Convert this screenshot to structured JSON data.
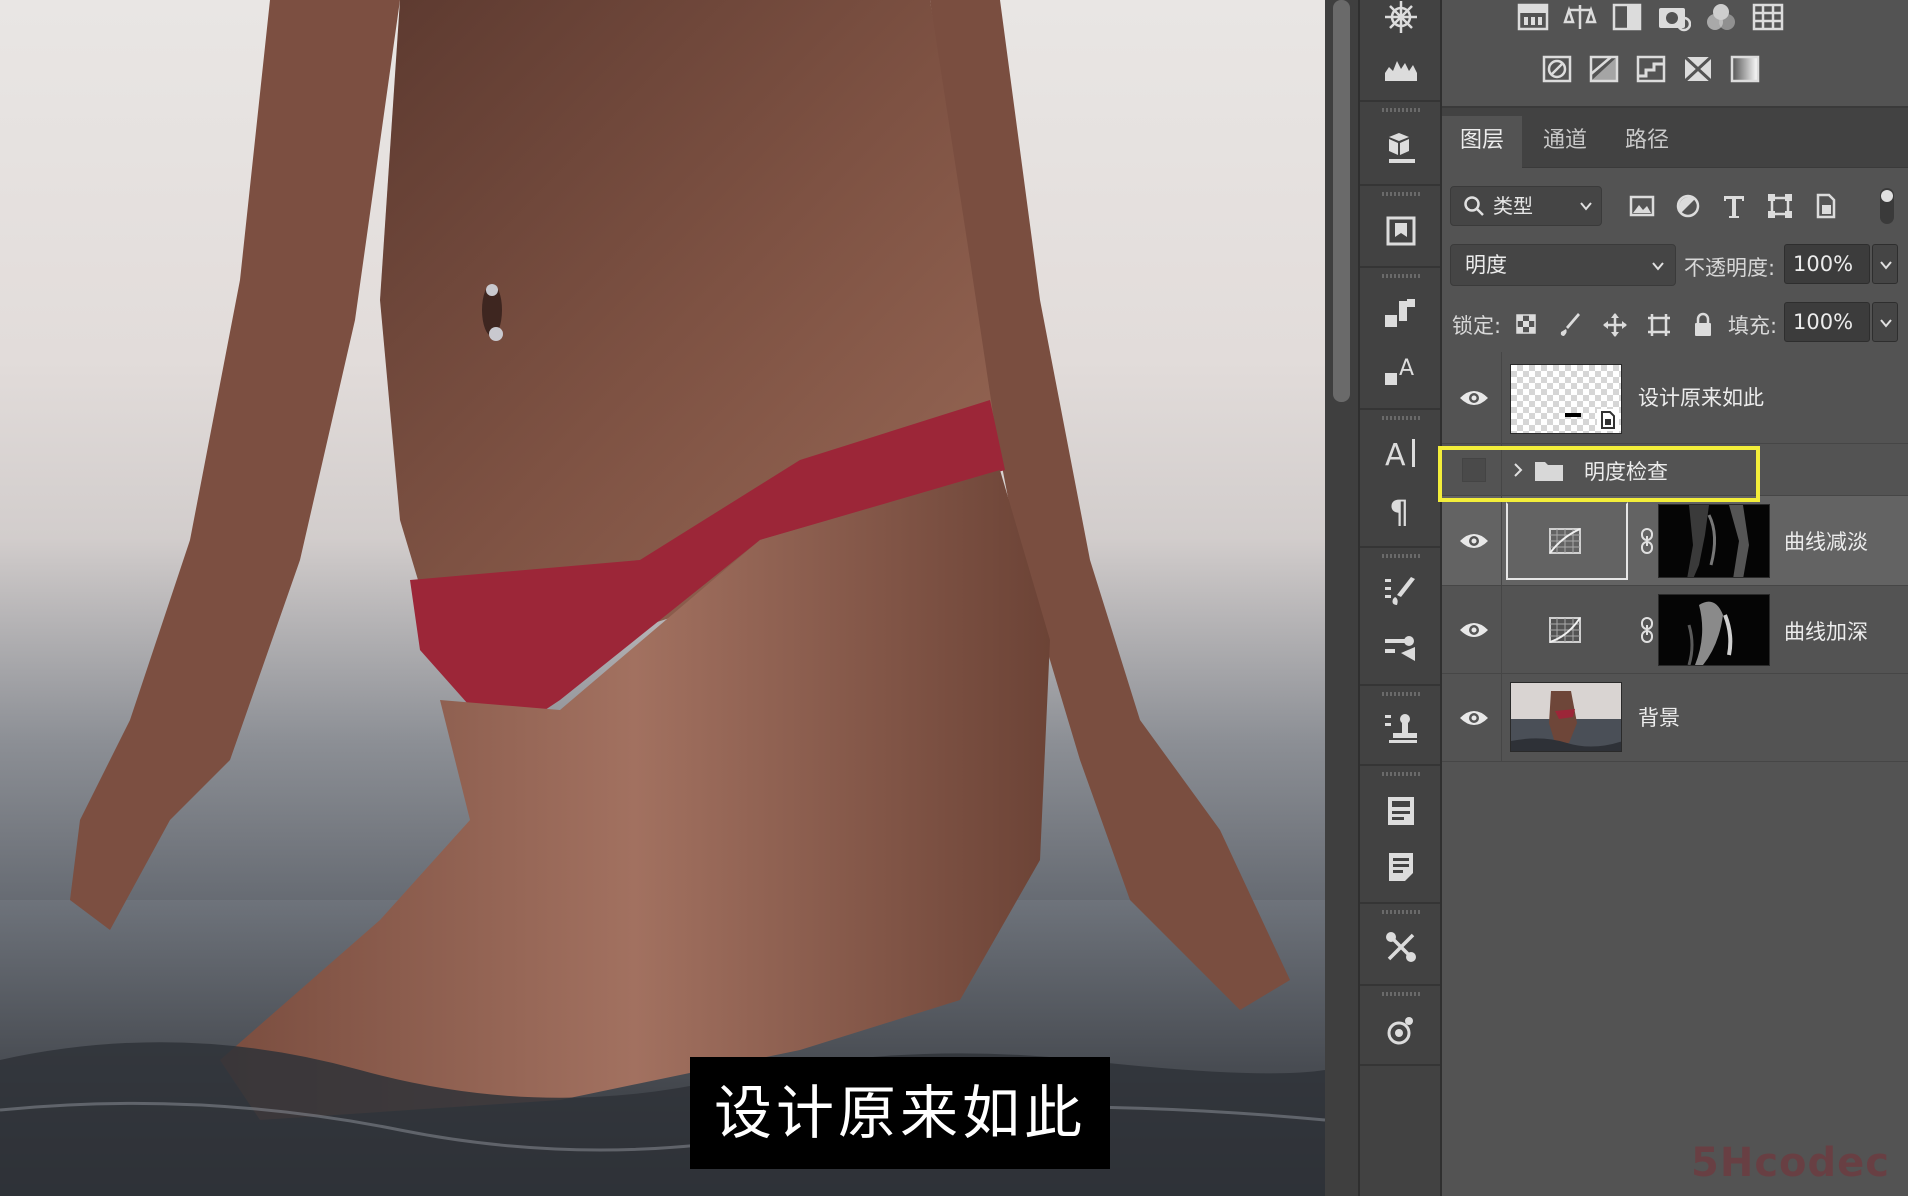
{
  "canvas": {
    "caption": "设计原来如此",
    "colors": {
      "skin_dark": "#6e4639",
      "skin_light": "#a06e5b",
      "swimsuit": "#9c2638",
      "sky": "#e6e2e0",
      "water": "#454a52"
    }
  },
  "panel": {
    "tabs": [
      "图层",
      "通道",
      "路径"
    ],
    "active_tab": "图层",
    "filter": {
      "label": "类型"
    },
    "blend_mode": "明度",
    "opacity": {
      "label": "不透明度:",
      "value": "100%"
    },
    "lock": {
      "label": "锁定:"
    },
    "fill": {
      "label": "填充:",
      "value": "100%"
    },
    "layers": [
      {
        "name": "设计原来如此",
        "type": "smart-object",
        "visible": true
      },
      {
        "name": "明度检查",
        "type": "group",
        "visible": false,
        "collapsed": true,
        "highlighted": true
      },
      {
        "name": "曲线减淡",
        "type": "curves-adjustment",
        "visible": true,
        "selected": true
      },
      {
        "name": "曲线加深",
        "type": "curves-adjustment",
        "visible": true
      },
      {
        "name": "背景",
        "type": "background",
        "visible": true
      }
    ]
  },
  "colors": {
    "highlight": "#f3ee3a",
    "panel_bg": "#535353",
    "dock_bg": "#424242"
  },
  "watermark": "5Hcodec"
}
